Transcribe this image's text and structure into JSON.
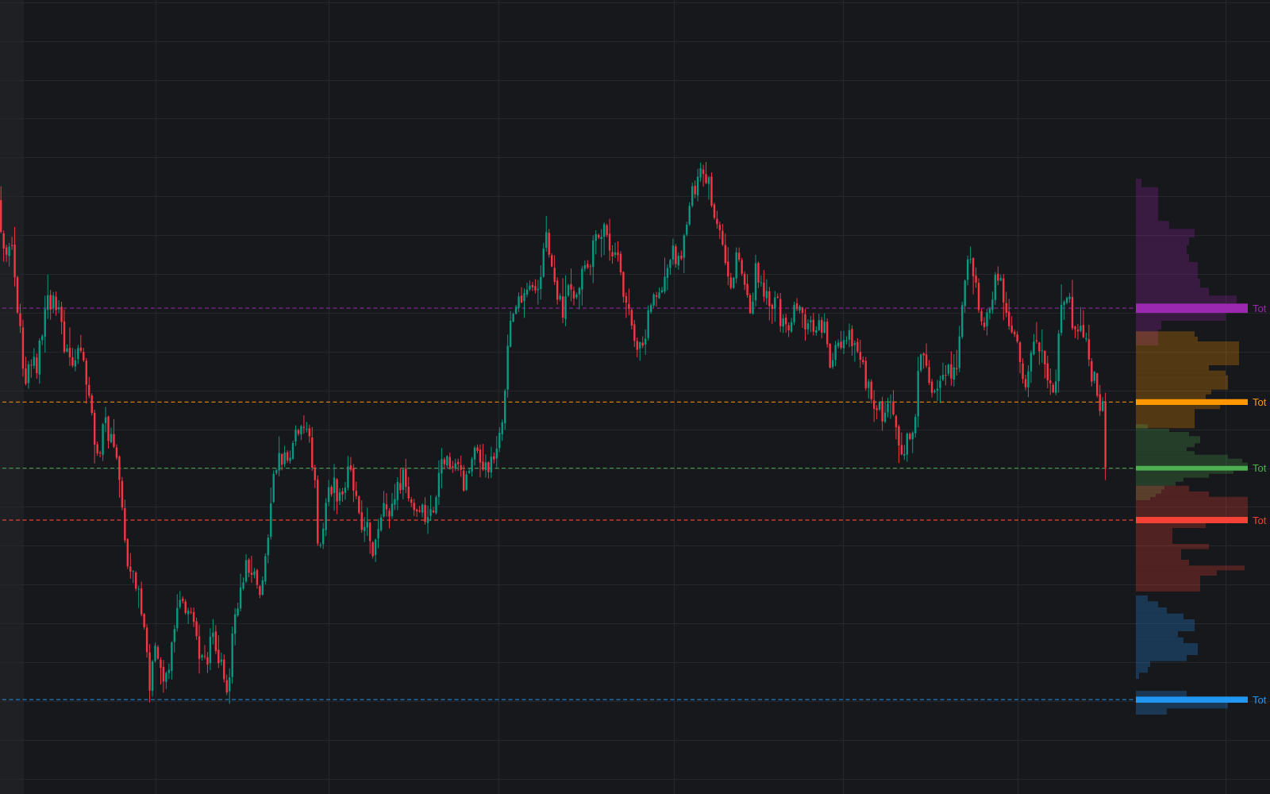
{
  "chart": {
    "profiles": [
      {
        "label": "Tot",
        "color": "#9c27b0"
      },
      {
        "label": "Tot",
        "color": "#ff9800"
      },
      {
        "label": "Tot",
        "color": "#4caf50"
      },
      {
        "label": "Tot",
        "color": "#f44336"
      },
      {
        "label": "Tot",
        "color": "#2196f3"
      }
    ]
  }
}
